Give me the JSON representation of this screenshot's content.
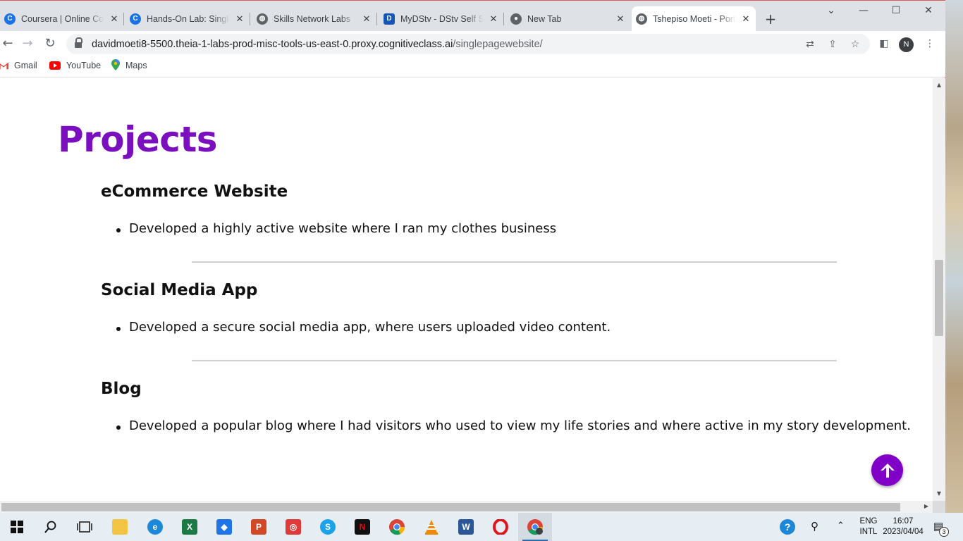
{
  "browser": {
    "tabs": [
      {
        "title": "Coursera | Online Courses & Credentials",
        "icon": "coursera-icon"
      },
      {
        "title": "Hands-On Lab: Single Page Website",
        "icon": "coursera-icon"
      },
      {
        "title": "Skills Network Labs",
        "icon": "globe-icon"
      },
      {
        "title": "MyDStv - DStv Self Service",
        "icon": "dstv-icon"
      },
      {
        "title": "New Tab",
        "icon": "chrome-icon"
      },
      {
        "title": "Tshepiso Moeti - Portfolio",
        "icon": "globe-icon",
        "active": true
      }
    ],
    "new_tab_label": "+",
    "url_host": "davidmoeti8-5500.theia-1-labs-prod-misc-tools-us-east-0.proxy.cognitiveclass.ai",
    "url_path": "/singlepagewebsite/",
    "profile_initial": "N",
    "bookmarks": [
      {
        "label": "Gmail",
        "icon": "gmail-icon"
      },
      {
        "label": "YouTube",
        "icon": "youtube-icon"
      },
      {
        "label": "Maps",
        "icon": "maps-icon"
      }
    ]
  },
  "page": {
    "section_title": "Projects",
    "projects": [
      {
        "title": "eCommerce Website",
        "item": "Developed a highly active website where I ran my clothes business"
      },
      {
        "title": "Social Media App",
        "item": "Developed a secure social media app, where users uploaded video content."
      },
      {
        "title": "Blog",
        "item": "Developed a popular blog where I had visitors who used to view my life stories and where active in my story development."
      }
    ]
  },
  "taskbar": {
    "lang_line1": "ENG",
    "lang_line2": "INTL",
    "time": "16:07",
    "date": "2023/04/04",
    "notification_count": "3"
  },
  "colors": {
    "accent": "#7b0fc0",
    "totop_button": "#8000c8"
  }
}
